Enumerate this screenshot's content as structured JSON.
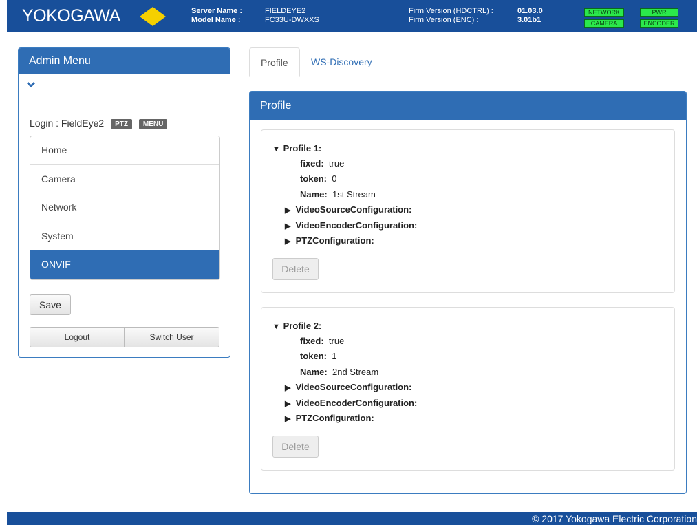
{
  "header": {
    "logo_text": "YOKOGAWA",
    "server_name_label": "Server Name :",
    "server_name": "FIELDEYE2",
    "model_name_label": "Model Name :",
    "model_name": "FC33U-DWXXS",
    "firm_hdctrl_label": "Firm Version (HDCTRL) :",
    "firm_hdctrl": "01.03.0",
    "firm_enc_label": "Firm Version (ENC) :",
    "firm_enc": "3.01b1",
    "indicators": [
      "NETWORK",
      "PWR",
      "CAMERA",
      "ENCODER"
    ],
    "indicator_color": "#2be84b",
    "brand_color": "#184f9a"
  },
  "admin_menu": {
    "title": "Admin Menu",
    "collapse_icon": "chevron-down-icon",
    "login_label": "Login : FieldEye2",
    "badges": [
      "PTZ",
      "MENU"
    ],
    "items": [
      "Home",
      "Camera",
      "Network",
      "System",
      "ONVIF"
    ],
    "active_item": "ONVIF",
    "save_label": "Save",
    "logout_label": "Logout",
    "switch_user_label": "Switch User"
  },
  "tabs": [
    {
      "label": "Profile",
      "active": true
    },
    {
      "label": "WS-Discovery",
      "active": false
    }
  ],
  "profile_panel": {
    "title": "Profile",
    "profiles": [
      {
        "heading": "Profile 1:",
        "fixed_label": "fixed:",
        "fixed": "true",
        "token_label": "token:",
        "token": "0",
        "name_label": "Name:",
        "name": "1st Stream",
        "sections": [
          "VideoSourceConfiguration:",
          "VideoEncoderConfiguration:",
          "PTZConfiguration:"
        ],
        "delete_label": "Delete"
      },
      {
        "heading": "Profile 2:",
        "fixed_label": "fixed:",
        "fixed": "true",
        "token_label": "token:",
        "token": "1",
        "name_label": "Name:",
        "name": "2nd Stream",
        "sections": [
          "VideoSourceConfiguration:",
          "VideoEncoderConfiguration:",
          "PTZConfiguration:"
        ],
        "delete_label": "Delete"
      }
    ]
  },
  "footer": {
    "copyright": "© 2017 Yokogawa Electric Corporation"
  }
}
